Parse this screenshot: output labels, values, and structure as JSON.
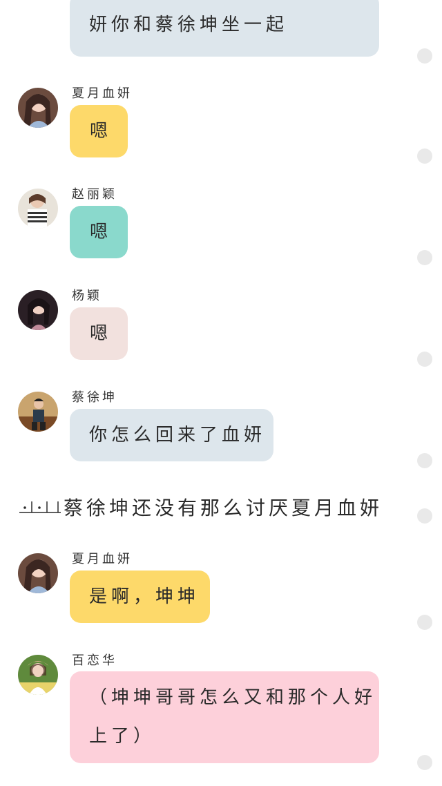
{
  "colors": {
    "bubble_blue": "#dde6ec",
    "bubble_yellow": "#fdd96a",
    "bubble_teal": "#8ad9cc",
    "bubble_pink_light": "#f2e1de",
    "bubble_pink": "#fdd0da",
    "dot": "#e9e9e9"
  },
  "messages": [
    {
      "sender": "",
      "text": "妍你和蔡徐坤坐一起",
      "bubble_color": "bubble_blue"
    },
    {
      "sender": "夏月血妍",
      "text": "嗯",
      "bubble_color": "bubble_yellow",
      "avatar": "avatar-xia-yue-xue-yan"
    },
    {
      "sender": "赵丽颖",
      "text": "嗯",
      "bubble_color": "bubble_teal",
      "avatar": "avatar-zhao-li-ying"
    },
    {
      "sender": "杨颖",
      "text": "嗯",
      "bubble_color": "bubble_pink_light",
      "avatar": "avatar-yang-ying"
    },
    {
      "sender": "蔡徐坤",
      "text": "你怎么回来了血妍",
      "bubble_color": "bubble_blue",
      "avatar": "avatar-cai-xu-kun"
    },
    {
      "sender": "夏月血妍",
      "text": "是啊，坤坤",
      "bubble_color": "bubble_yellow",
      "avatar": "avatar-xia-yue-xue-yan"
    },
    {
      "sender": "百恋华",
      "text_line1": "（坤坤哥哥怎么又和那个人好",
      "text_line2": "上了）",
      "bubble_color": "bubble_pink",
      "avatar": "avatar-bai-lian-hua"
    }
  ],
  "narration": {
    "text": "蔡徐坤还没有那么讨厌夏月血妍"
  }
}
